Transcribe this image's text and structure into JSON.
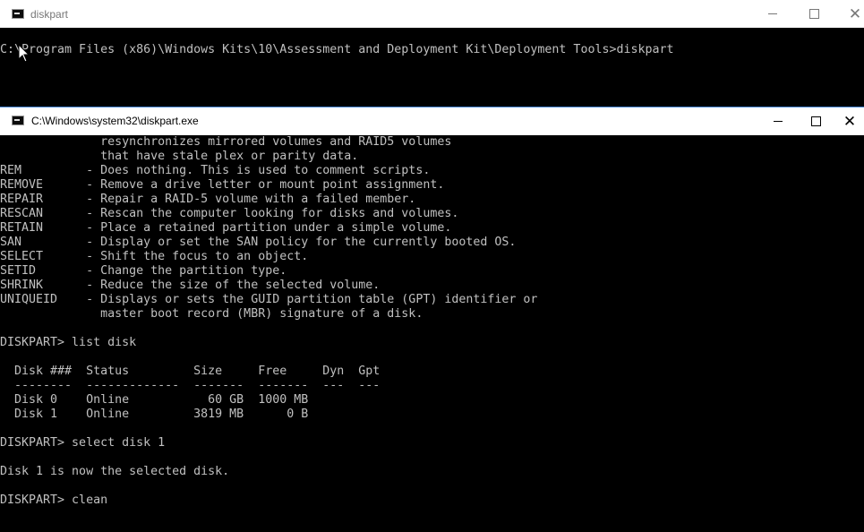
{
  "back_window": {
    "title": "diskpart",
    "console_lines": [
      "C:\\Program Files (x86)\\Windows Kits\\10\\Assessment and Deployment Kit\\Deployment Tools>diskpart"
    ]
  },
  "front_window": {
    "title": "C:\\Windows\\system32\\diskpart.exe",
    "console_lines": [
      "              resynchronizes mirrored volumes and RAID5 volumes",
      "              that have stale plex or parity data.",
      "REM         - Does nothing. This is used to comment scripts.",
      "REMOVE      - Remove a drive letter or mount point assignment.",
      "REPAIR      - Repair a RAID-5 volume with a failed member.",
      "RESCAN      - Rescan the computer looking for disks and volumes.",
      "RETAIN      - Place a retained partition under a simple volume.",
      "SAN         - Display or set the SAN policy for the currently booted OS.",
      "SELECT      - Shift the focus to an object.",
      "SETID       - Change the partition type.",
      "SHRINK      - Reduce the size of the selected volume.",
      "UNIQUEID    - Displays or sets the GUID partition table (GPT) identifier or",
      "              master boot record (MBR) signature of a disk.",
      "",
      "DISKPART> list disk",
      "",
      "  Disk ###  Status         Size     Free     Dyn  Gpt",
      "  --------  -------------  -------  -------  ---  ---",
      "  Disk 0    Online           60 GB  1000 MB",
      "  Disk 1    Online         3819 MB      0 B",
      "",
      "DISKPART> select disk 1",
      "",
      "Disk 1 is now the selected disk.",
      "",
      "DISKPART> clean"
    ]
  },
  "icons": {
    "app": "console-app-icon",
    "minimize": "minimize-icon",
    "maximize": "maximize-icon",
    "close": "close-icon",
    "cursor": "mouse-cursor-icon"
  },
  "colors": {
    "console_bg": "#000000",
    "console_text": "#c0c0c0",
    "titlebar_bg": "#ffffff",
    "active_border": "#4a8ad8"
  }
}
